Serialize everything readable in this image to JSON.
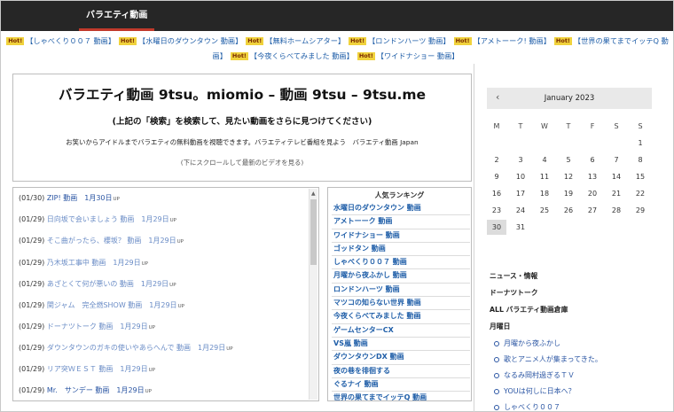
{
  "nav": {
    "home_label": "バラエティ動画"
  },
  "hot_badge": "Hot!",
  "hotlinks": [
    "【しゃべくり００７ 動画】",
    "【水曜日のダウンタウン 動画】",
    "【無料ホームシアター】",
    "【ロンドンハーツ 動画】",
    "【アメトーーク! 動画】",
    "【世界の果てまでイッテQ 動画】",
    "【今夜くらべてみました 動画】",
    "【ワイドナショー 動画】"
  ],
  "hero": {
    "title": "バラエティ動画 9tsu。miomio – 動画 9tsu – 9tsu.me",
    "subtitle": "(上記の「検索」を検索して、見たい動画をさらに見つけてください)",
    "description": "お笑いからアイドルまでバラエティの無料動画を視聴できます。バラエティテレビ番組を見よう　バラエティ動画 Japan",
    "note": "(下にスクロールして最新のビデオを見る)"
  },
  "videos": [
    {
      "date": "(01/30)",
      "title": "ZIP! 動画　1月30日",
      "badge": "UP",
      "old": false
    },
    {
      "date": "(01/29)",
      "title": "日向坂で会いましょう 動画　1月29日",
      "badge": "UP",
      "old": true
    },
    {
      "date": "(01/29)",
      "title": "そこ曲がったら、櫻坂？ 動画　1月29日",
      "badge": "UP",
      "old": true
    },
    {
      "date": "(01/29)",
      "title": "乃木坂工事中 動画　1月29日",
      "badge": "UP",
      "old": true
    },
    {
      "date": "(01/29)",
      "title": "あざとくて何が悪いの 動画　1月29日",
      "badge": "UP",
      "old": true
    },
    {
      "date": "(01/29)",
      "title": "関ジャム　完全燃SHOW 動画　1月29日",
      "badge": "UP",
      "old": true
    },
    {
      "date": "(01/29)",
      "title": "ドーナツトーク 動画　1月29日",
      "badge": "UP",
      "old": true
    },
    {
      "date": "(01/29)",
      "title": "ダウンタウンのガキの使いやあらへんで 動画　1月29日",
      "badge": "UP",
      "old": true
    },
    {
      "date": "(01/29)",
      "title": "リア突ＷＥＳＴ 動画　1月29日",
      "badge": "UP",
      "old": true
    },
    {
      "date": "(01/29)",
      "title": "Mr.　サンデー 動画　1月29日",
      "badge": "UP",
      "old": false
    }
  ],
  "ranking": {
    "title": "人気ランキング",
    "items": [
      "水曜日のダウンタウン 動画",
      "アメトーーク 動画",
      "ワイドナショー 動画",
      "ゴッドタン 動画",
      "しゃべくり００７ 動画",
      "月曜から夜ふかし 動画",
      "ロンドンハーツ 動画",
      "マツコの知らない世界 動画",
      "今夜くらべてみました 動画",
      "ゲームセンターCX",
      "VS嵐 動画",
      "ダウンタウンDX 動画",
      "夜の巷を徘徊する",
      "ぐるナイ 動画",
      "世界の果てまでイッテQ 動画"
    ]
  },
  "calendar": {
    "prev_symbol": "‹",
    "month_label": "January 2023",
    "days_of_week": [
      "M",
      "T",
      "W",
      "T",
      "F",
      "S",
      "S"
    ],
    "weeks": [
      [
        "",
        "",
        "",
        "",
        "",
        "",
        "1"
      ],
      [
        "2",
        "3",
        "4",
        "5",
        "6",
        "7",
        "8"
      ],
      [
        "9",
        "10",
        "11",
        "12",
        "13",
        "14",
        "15"
      ],
      [
        "16",
        "17",
        "18",
        "19",
        "20",
        "21",
        "22"
      ],
      [
        "23",
        "24",
        "25",
        "26",
        "27",
        "28",
        "29"
      ],
      [
        "30",
        "31",
        "",
        "",
        "",
        "",
        ""
      ]
    ],
    "highlighted_day": "30"
  },
  "sidebar": {
    "headings": [
      "ニュース・情報",
      "ドーナツトーク",
      "ALL バラエティ動画倉庫",
      "月曜日"
    ],
    "monday_items": [
      "月曜から夜ふかし",
      "歌とアニメ人が集まってきた。",
      "なるみ岡村過ぎるＴＶ",
      "YOUは何しに日本へ？",
      "しゃべくり００７"
    ]
  }
}
